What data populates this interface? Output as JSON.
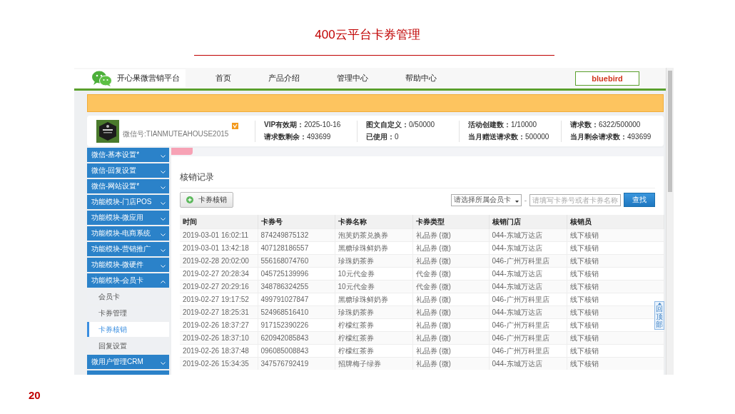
{
  "slide": {
    "title": "400云平台卡券管理",
    "page_number": "20"
  },
  "app": {
    "brand": "开心果微营销平台",
    "nav_links": [
      {
        "label": "首页"
      },
      {
        "label": "产品介绍"
      },
      {
        "label": "管理中心"
      },
      {
        "label": "帮助中心"
      }
    ],
    "user_button": "bluebird",
    "account": {
      "wechat_id": "微信号:TIANMUTEAHOUSE2015",
      "stats": [
        {
          "label": "VIP有效期：",
          "value": "2025-10-16"
        },
        {
          "label": "请求数剩余：",
          "value": "493699"
        },
        {
          "label": "图文自定义：",
          "value": "0/50000"
        },
        {
          "label": "已使用：",
          "value": "0"
        },
        {
          "label": "活动创建数：",
          "value": "1/10000"
        },
        {
          "label": "当月赠送请求数：",
          "value": "500000"
        },
        {
          "label": "请求数：",
          "value": "6322/500000"
        },
        {
          "label": "当月剩余请求数：",
          "value": "493699"
        }
      ]
    },
    "sidebar": {
      "items": [
        {
          "label": "微信-基本设置*",
          "expanded": false
        },
        {
          "label": "微信-回复设置",
          "expanded": false
        },
        {
          "label": "微信-网站设置*",
          "expanded": false
        },
        {
          "label": "功能模块-门店POS",
          "expanded": false
        },
        {
          "label": "功能模块-微应用",
          "expanded": false
        },
        {
          "label": "功能模块-电商系统",
          "expanded": false
        },
        {
          "label": "功能模块-营销推广",
          "expanded": false
        },
        {
          "label": "功能模块-微硬件",
          "expanded": false
        },
        {
          "label": "功能模块-会员卡",
          "expanded": true,
          "children": [
            {
              "label": "会员卡",
              "selected": false
            },
            {
              "label": "卡券管理",
              "selected": false
            },
            {
              "label": "卡券核销",
              "selected": true
            },
            {
              "label": "回复设置",
              "selected": false
            }
          ]
        },
        {
          "label": "微用户管理CRM",
          "expanded": false
        }
      ]
    },
    "content": {
      "title": "核销记录",
      "add_button": "卡券核销",
      "card_select": {
        "placeholder": "请选择所属会员卡"
      },
      "separator": "-",
      "search": {
        "placeholder": "请填写卡券号或者卡券名称"
      },
      "search_button": "查找",
      "table": {
        "columns": [
          "时间",
          "卡券号",
          "卡券名称",
          "卡券类型",
          "核销门店",
          "核销员"
        ],
        "rows": [
          [
            "2019-03-01 16:02:11",
            "874249875132",
            "泡芙奶茶兑换券",
            "礼品券 (微)",
            "044-东城万达店",
            "线下核销"
          ],
          [
            "2019-03-01 13:42:18",
            "407128186557",
            "黑糖珍珠鲜奶券",
            "礼品券 (微)",
            "044-东城万达店",
            "线下核销"
          ],
          [
            "2019-02-28 20:02:00",
            "556168074760",
            "珍珠奶茶券",
            "礼品券 (微)",
            "046-广州万科里店",
            "线下核销"
          ],
          [
            "2019-02-27 20:28:34",
            "045725139996",
            "10元代金券",
            "代金券 (微)",
            "044-东城万达店",
            "线下核销"
          ],
          [
            "2019-02-27 20:29:16",
            "348786324255",
            "10元代金券",
            "代金券 (微)",
            "044-东城万达店",
            "线下核销"
          ],
          [
            "2019-02-27 19:17:52",
            "499791027847",
            "黑糖珍珠鲜奶券",
            "礼品券 (微)",
            "046-广州万科里店",
            "线下核销"
          ],
          [
            "2019-02-27 18:25:31",
            "524968516410",
            "珍珠奶茶券",
            "礼品券 (微)",
            "044-东城万达店",
            "线下核销"
          ],
          [
            "2019-02-26 18:37:27",
            "917152390226",
            "柠檬红茶券",
            "礼品券 (微)",
            "046-广州万科里店",
            "线下核销"
          ],
          [
            "2019-02-26 18:37:10",
            "620942085843",
            "柠檬红茶券",
            "礼品券 (微)",
            "046-广州万科里店",
            "线下核销"
          ],
          [
            "2019-02-26 18:37:48",
            "096085008843",
            "柠檬红茶券",
            "礼品券 (微)",
            "046-广州万科里店",
            "线下核销"
          ],
          [
            "2019-02-26 15:34:35",
            "347576792419",
            "招牌梅子绿券",
            "礼品券 (微)",
            "044-东城万达店",
            "线下核销"
          ]
        ]
      },
      "back_to_top": "回顶部"
    }
  }
}
